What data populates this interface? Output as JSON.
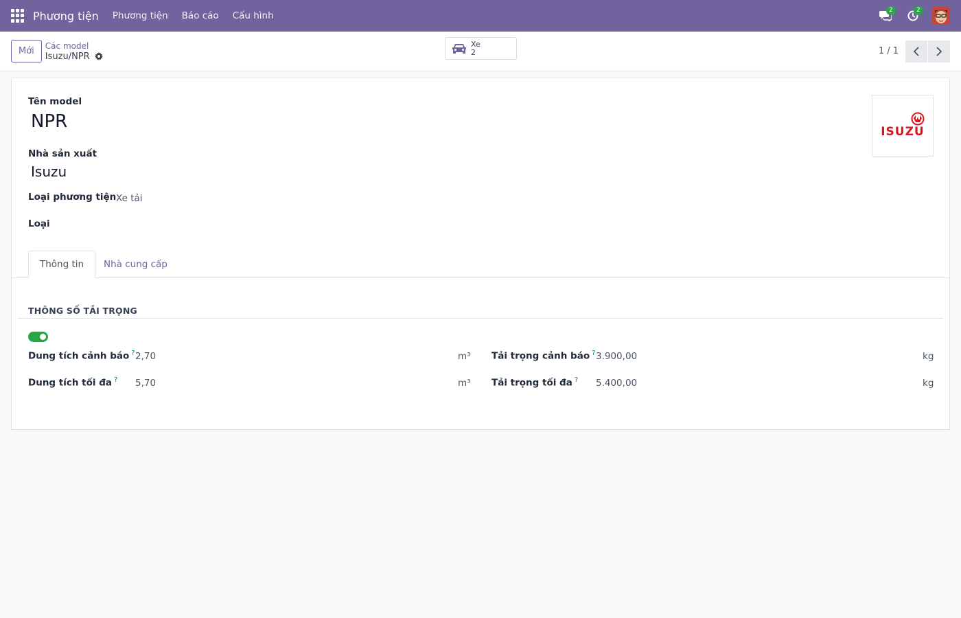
{
  "navbar": {
    "brand": "Phương tiện",
    "menu": [
      "Phương tiện",
      "Báo cáo",
      "Cấu hình"
    ],
    "messages_count": "2",
    "activities_count": "2"
  },
  "control": {
    "new_label": "Mới",
    "breadcrumb_parent": "Các model",
    "breadcrumb_current": "Isuzu/NPR",
    "smart_button": {
      "label": "Xe",
      "count": "2"
    },
    "pager": "1 / 1"
  },
  "form": {
    "model_name_label": "Tên model",
    "model_name": "NPR",
    "manufacturer_label": "Nhà sản xuất",
    "manufacturer": "Isuzu",
    "vehicle_type_label": "Loại phương tiện",
    "vehicle_type": "Xe tải",
    "category_label": "Loại",
    "logo_text": "ISUZU"
  },
  "tabs": [
    "Thông tin",
    "Nhà cung cấp"
  ],
  "capacity_section": {
    "title": "THÔNG SỐ TẢI TRỌNG",
    "toggle_on": true,
    "fields": {
      "volume_warning_label": "Dung tích cảnh báo",
      "volume_warning": "2,70",
      "volume_max_label": "Dung tích tối đa",
      "volume_max": "5,70",
      "volume_unit": "m³",
      "weight_warning_label": "Tải trọng cảnh báo",
      "weight_warning": "3.900,00",
      "weight_max_label": "Tải trọng tối đa",
      "weight_max": "5.400,00",
      "weight_unit": "kg",
      "help_mark": "?"
    }
  },
  "colors": {
    "navbar": "#71639e",
    "accent": "#71639e",
    "toggle": "#28a745",
    "logo_red": "#d5161f"
  }
}
